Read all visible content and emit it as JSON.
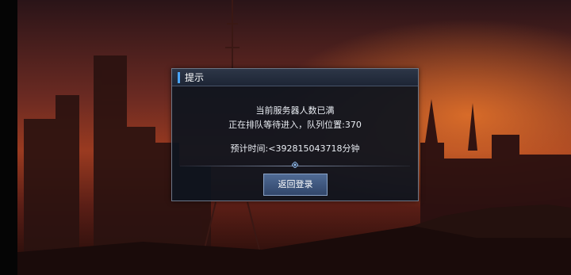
{
  "dialog": {
    "title": "提示",
    "message_line1": "当前服务器人数已满",
    "message_line2": "正在排队等待进入，队列位置:370",
    "estimate_line": "预计时间:<392815043718分钟",
    "return_button_label": "返回登录"
  },
  "colors": {
    "accent": "#4aa6ff",
    "dialog_bg": "#0e141e",
    "button": "#3e5680"
  }
}
